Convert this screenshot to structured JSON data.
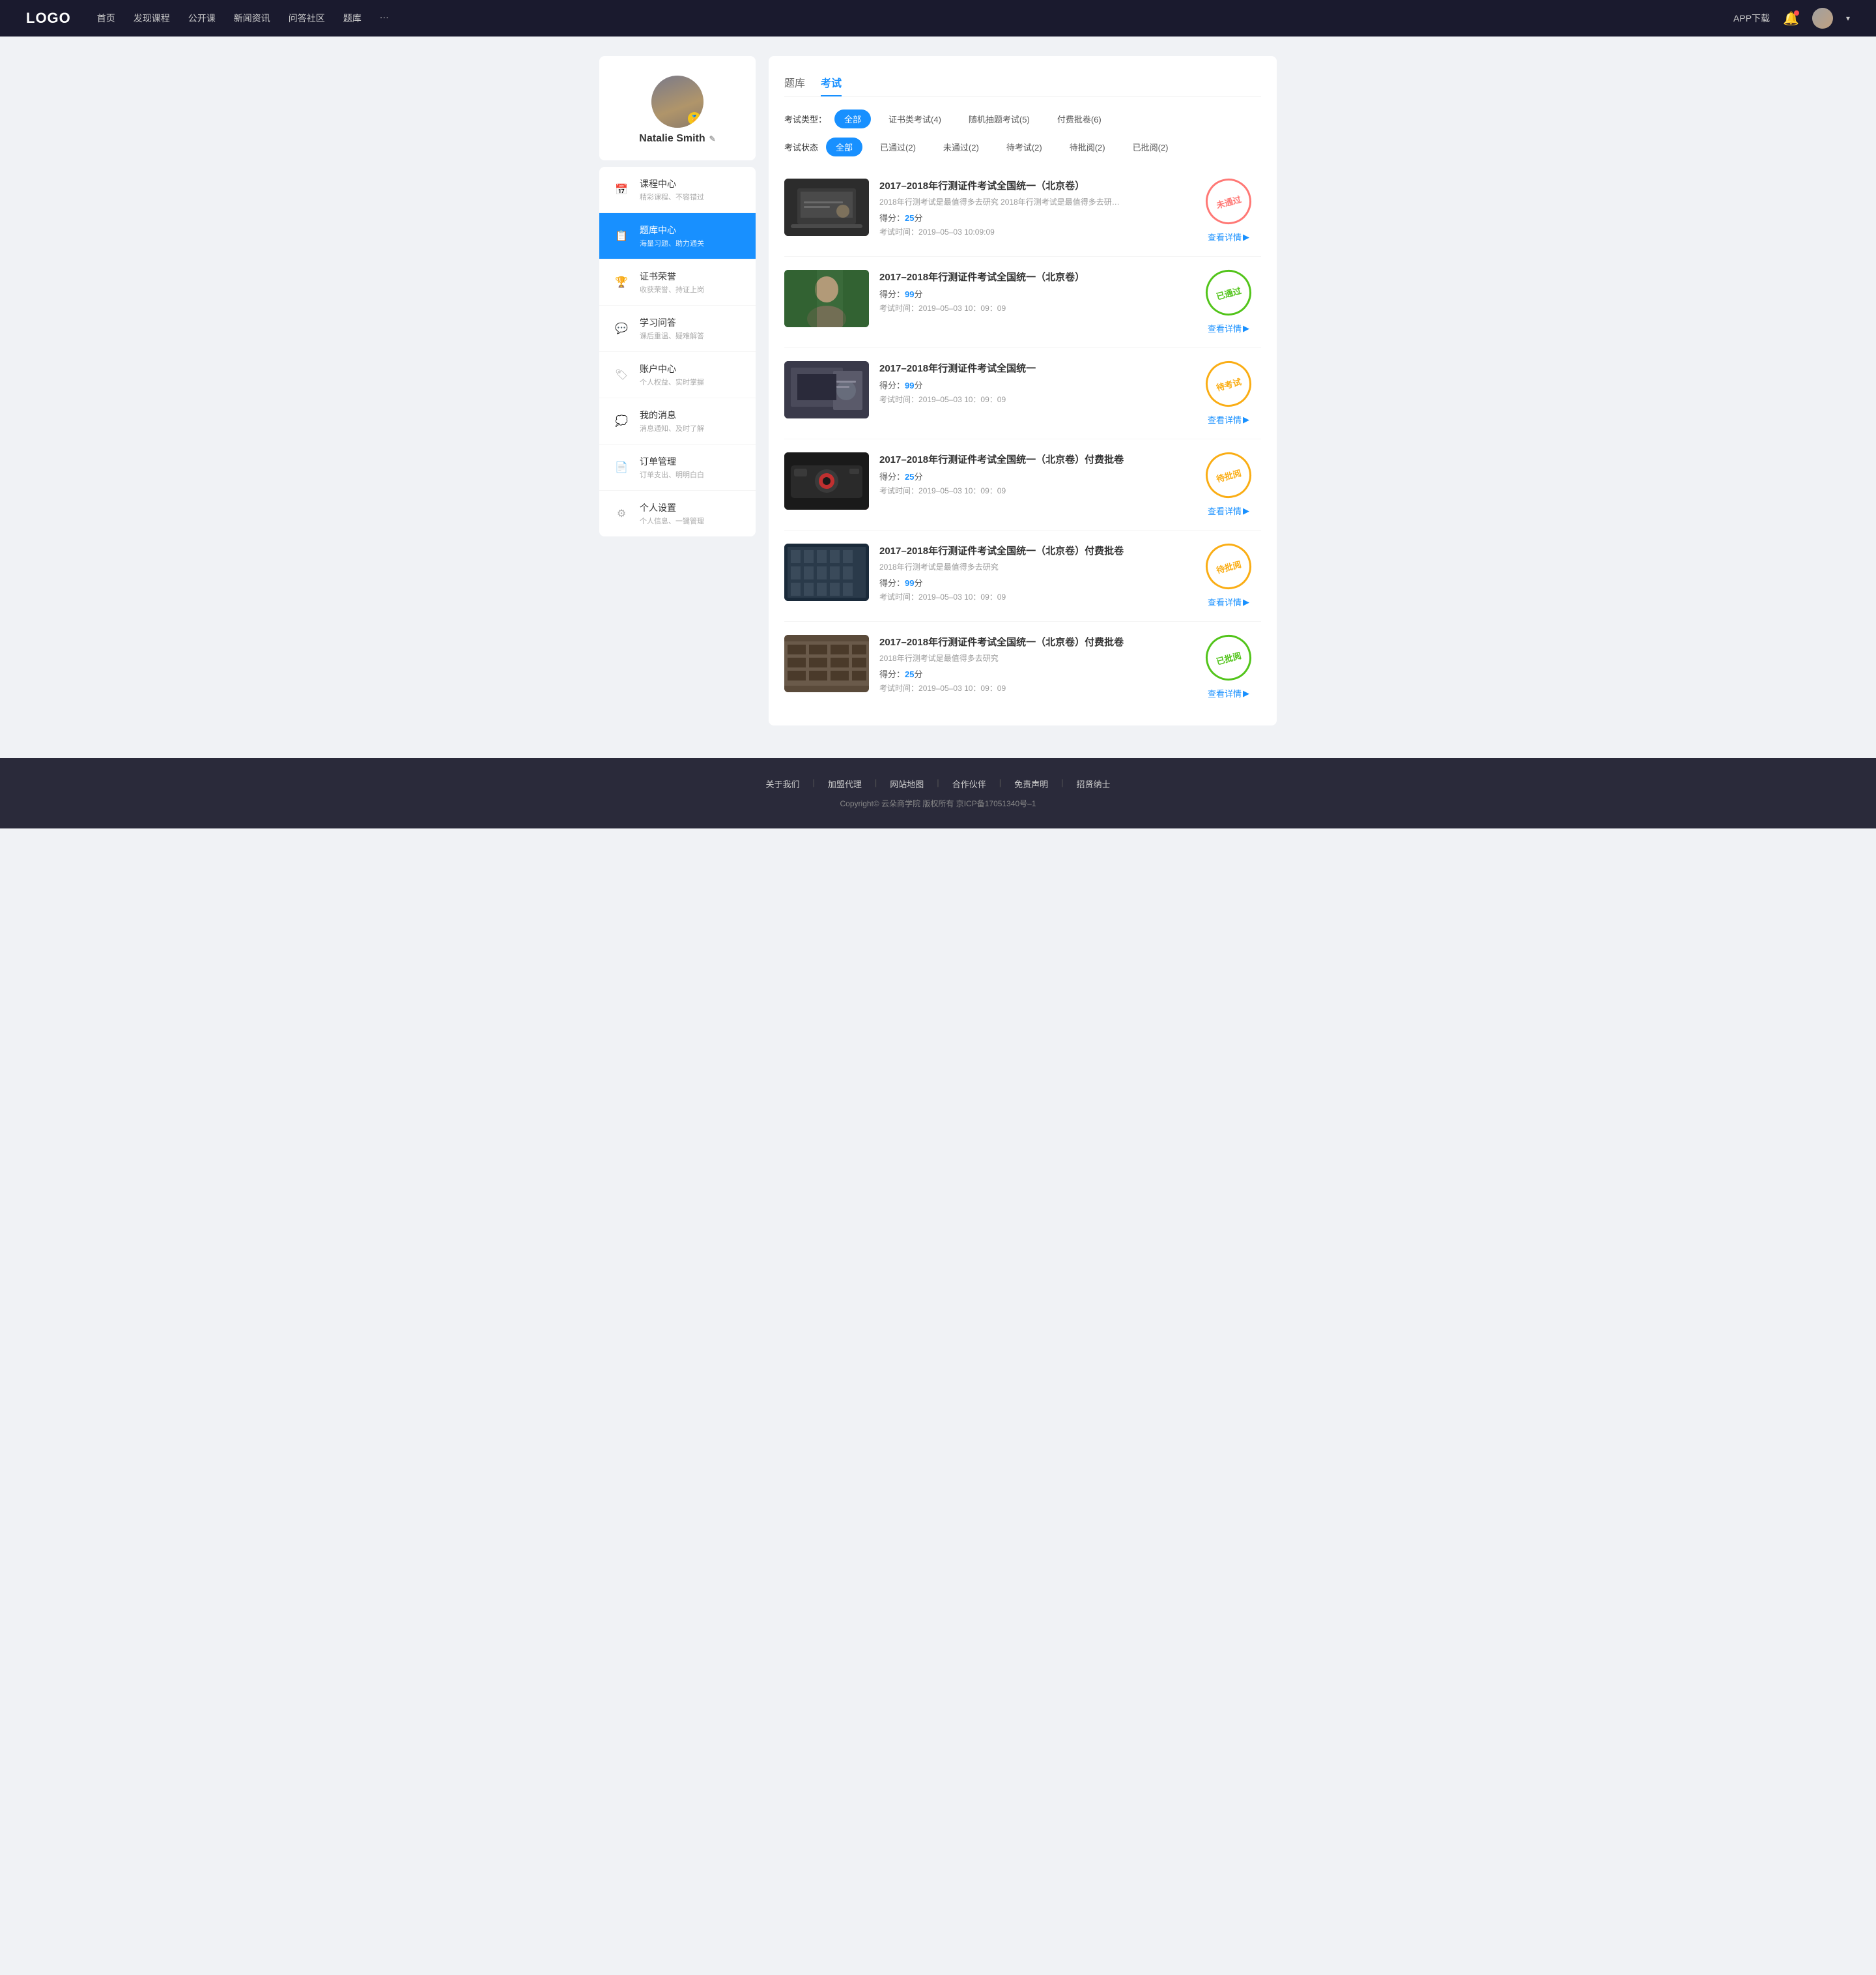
{
  "header": {
    "logo": "LOGO",
    "nav": [
      {
        "label": "首页",
        "id": "home"
      },
      {
        "label": "发现课程",
        "id": "discover"
      },
      {
        "label": "公开课",
        "id": "opencourse"
      },
      {
        "label": "新闻资讯",
        "id": "news"
      },
      {
        "label": "问答社区",
        "id": "qa"
      },
      {
        "label": "题库",
        "id": "questionbank"
      },
      {
        "label": "···",
        "id": "more"
      }
    ],
    "app_download": "APP下载",
    "dropdown_arrow": "▾"
  },
  "sidebar": {
    "user": {
      "name": "Natalie Smith",
      "badge_icon": "🏅",
      "edit_icon": "✎"
    },
    "menu": [
      {
        "id": "course-center",
        "icon": "📅",
        "title": "课程中心",
        "subtitle": "精彩课程、不容错过",
        "active": false
      },
      {
        "id": "question-bank",
        "icon": "📋",
        "title": "题库中心",
        "subtitle": "海量习题、助力通关",
        "active": true
      },
      {
        "id": "certificate",
        "icon": "🏆",
        "title": "证书荣誉",
        "subtitle": "收获荣誉、持证上岗",
        "active": false
      },
      {
        "id": "study-qa",
        "icon": "💬",
        "title": "学习问答",
        "subtitle": "课后重温、疑难解答",
        "active": false
      },
      {
        "id": "account-center",
        "icon": "🏷",
        "title": "账户中心",
        "subtitle": "个人权益、实时掌握",
        "active": false
      },
      {
        "id": "my-messages",
        "icon": "💭",
        "title": "我的消息",
        "subtitle": "消息通知、及时了解",
        "active": false
      },
      {
        "id": "order-management",
        "icon": "📄",
        "title": "订单管理",
        "subtitle": "订单支出、明明白白",
        "active": false
      },
      {
        "id": "personal-settings",
        "icon": "⚙",
        "title": "个人设置",
        "subtitle": "个人信息、一键管理",
        "active": false
      }
    ]
  },
  "content": {
    "tabs": [
      {
        "id": "question-bank-tab",
        "label": "题库"
      },
      {
        "id": "exam-tab",
        "label": "考试",
        "active": true
      }
    ],
    "exam_type_filter": {
      "label": "考试类型：",
      "options": [
        {
          "id": "all",
          "label": "全部",
          "active": true
        },
        {
          "id": "certificate",
          "label": "证书类考试(4)",
          "active": false
        },
        {
          "id": "random",
          "label": "随机抽题考试(5)",
          "active": false
        },
        {
          "id": "paid",
          "label": "付费批卷(6)",
          "active": false
        }
      ]
    },
    "exam_status_filter": {
      "label": "考试状态",
      "options": [
        {
          "id": "all",
          "label": "全部",
          "active": true
        },
        {
          "id": "passed",
          "label": "已通过(2)",
          "active": false
        },
        {
          "id": "failed",
          "label": "未通过(2)",
          "active": false
        },
        {
          "id": "pending",
          "label": "待考试(2)",
          "active": false
        },
        {
          "id": "to-review",
          "label": "待批阅(2)",
          "active": false
        },
        {
          "id": "reviewed",
          "label": "已批阅(2)",
          "active": false
        }
      ]
    },
    "exams": [
      {
        "id": "exam-1",
        "title": "2017–2018年行测证件考试全国统一（北京卷）",
        "description": "2018年行测考试是最值得多去研究  2018年行测考试是最值得多去研究  2018年行...",
        "score": "25",
        "time": "2019–05–03  10:09:09",
        "status": "fail",
        "status_label": "未通过",
        "detail_link": "查看详情",
        "thumb_class": "thumb-laptop"
      },
      {
        "id": "exam-2",
        "title": "2017–2018年行测证件考试全国统一（北京卷）",
        "description": "",
        "score": "99",
        "time": "2019–05–03  10：09：09",
        "status": "pass",
        "status_label": "已通过",
        "detail_link": "查看详情",
        "thumb_class": "thumb-person"
      },
      {
        "id": "exam-3",
        "title": "2017–2018年行测证件考试全国统一",
        "description": "",
        "score": "99",
        "time": "2019–05–03  10：09：09",
        "status": "pending",
        "status_label": "待考试",
        "detail_link": "查看详情",
        "thumb_class": "thumb-office"
      },
      {
        "id": "exam-4",
        "title": "2017–2018年行测证件考试全国统一（北京卷）付费批卷",
        "description": "",
        "score": "25",
        "time": "2019–05–03  10：09：09",
        "status": "pending",
        "status_label": "待批阅",
        "detail_link": "查看详情",
        "thumb_class": "thumb-camera"
      },
      {
        "id": "exam-5",
        "title": "2017–2018年行测证件考试全国统一（北京卷）付费批卷",
        "description": "2018年行测考试是最值得多去研究",
        "score": "99",
        "time": "2019–05–03  10：09：09",
        "status": "pending",
        "status_label": "待批阅",
        "detail_link": "查看详情",
        "thumb_class": "thumb-building1"
      },
      {
        "id": "exam-6",
        "title": "2017–2018年行测证件考试全国统一（北京卷）付费批卷",
        "description": "2018年行测考试是最值得多去研究",
        "score": "25",
        "time": "2019–05–03  10：09：09",
        "status": "reviewed",
        "status_label": "已批阅",
        "detail_link": "查看详情",
        "thumb_class": "thumb-building2"
      }
    ]
  },
  "footer": {
    "links": [
      {
        "label": "关于我们"
      },
      {
        "label": "加盟代理"
      },
      {
        "label": "网站地图"
      },
      {
        "label": "合作伙伴"
      },
      {
        "label": "免责声明"
      },
      {
        "label": "招贤纳士"
      }
    ],
    "copyright": "Copyright©  云朵商学院  版权所有     京ICP备17051340号–1"
  }
}
